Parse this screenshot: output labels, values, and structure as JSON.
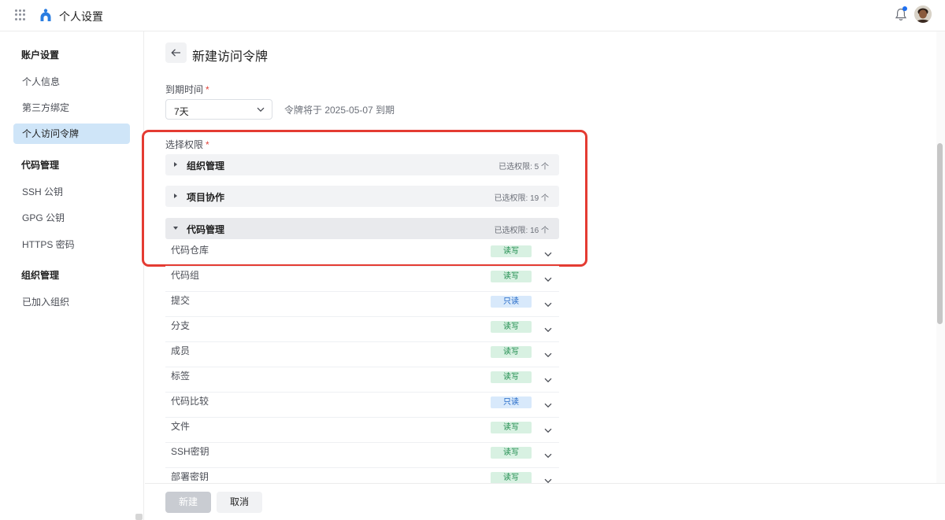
{
  "header": {
    "app_title": "个人设置",
    "icons": [
      "apps-grid-icon",
      "logo-icon",
      "bell-icon",
      "avatar"
    ],
    "notification_dot_color": "#1e6ff0"
  },
  "sidebar": {
    "groups": [
      {
        "title": "账户设置",
        "items": [
          {
            "label": "个人信息",
            "active": false
          },
          {
            "label": "第三方绑定",
            "active": false
          },
          {
            "label": "个人访问令牌",
            "active": true
          }
        ]
      },
      {
        "title": "代码管理",
        "items": [
          {
            "label": "SSH 公钥",
            "active": false
          },
          {
            "label": "GPG 公钥",
            "active": false
          },
          {
            "label": "HTTPS 密码",
            "active": false
          }
        ]
      },
      {
        "title": "组织管理",
        "items": [
          {
            "label": "已加入组织",
            "active": false
          }
        ]
      }
    ]
  },
  "page": {
    "title": "新建访问令牌",
    "back_icon": "arrow-left-icon"
  },
  "form": {
    "expire_label": "到期时间",
    "required_mark": "*",
    "expire_value": "7天",
    "expire_note": "令牌将于 2025-05-07 到期",
    "permission_label": "选择权限"
  },
  "permission_groups": [
    {
      "name": "组织管理",
      "count": "已选权限: 5 个",
      "expanded": false
    },
    {
      "name": "项目协作",
      "count": "已选权限: 19 个",
      "expanded": false
    },
    {
      "name": "代码管理",
      "count": "已选权限: 16 个",
      "expanded": true
    }
  ],
  "permissions": [
    {
      "name": "代码仓库",
      "access": "读写",
      "kind": "rw"
    },
    {
      "name": "代码组",
      "access": "读写",
      "kind": "rw"
    },
    {
      "name": "提交",
      "access": "只读",
      "kind": "ro"
    },
    {
      "name": "分支",
      "access": "读写",
      "kind": "rw"
    },
    {
      "name": "成员",
      "access": "读写",
      "kind": "rw"
    },
    {
      "name": "标签",
      "access": "读写",
      "kind": "rw"
    },
    {
      "name": "代码比较",
      "access": "只读",
      "kind": "ro"
    },
    {
      "name": "文件",
      "access": "读写",
      "kind": "rw"
    },
    {
      "name": "SSH密钥",
      "access": "读写",
      "kind": "rw"
    },
    {
      "name": "部署密钥",
      "access": "读写",
      "kind": "rw"
    }
  ],
  "footer": {
    "create_label": "新建",
    "cancel_label": "取消"
  },
  "colors": {
    "highlight_border": "#e43b32",
    "active_nav_bg": "#cfe5f8",
    "rw_badge_bg": "#d8f1e2",
    "ro_badge_bg": "#d8e9fb"
  }
}
